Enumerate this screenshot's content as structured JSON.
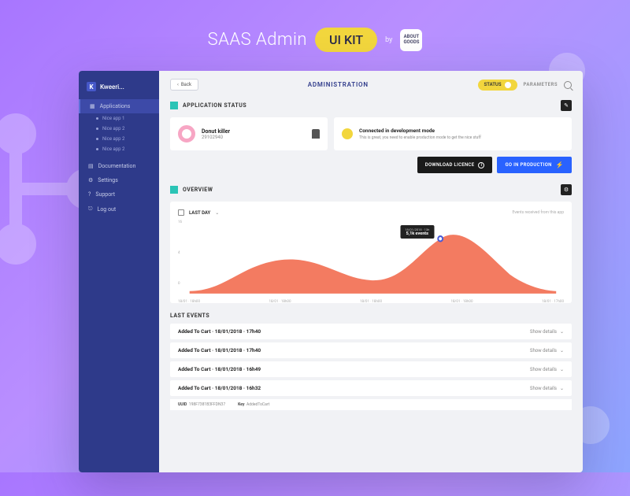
{
  "promo": {
    "title": "SAAS Admin",
    "badge": "UI KIT",
    "by": "by",
    "logo": "ABOUT GOODS"
  },
  "brand": {
    "letter": "K",
    "name": "Kweeri..."
  },
  "sidebar": {
    "applications": {
      "label": "Applications",
      "items": [
        "Nice app 1",
        "Nice app 2",
        "Nice app 2",
        "Nice app 2"
      ]
    },
    "documentation": "Documentation",
    "settings": "Settings",
    "support": "Support",
    "logout": "Log out"
  },
  "topbar": {
    "back": "Back",
    "title": "ADMINISTRATION",
    "status": "STATUS",
    "params": "PARAMETERS"
  },
  "status_section": {
    "title": "APPLICATION STATUS",
    "app": {
      "name": "Donut killer",
      "id": "29102940"
    },
    "conn": {
      "title": "Connected in development mode",
      "sub": "This is great, you need to enable production mode to get the nice stuff"
    },
    "btn_download": "DOWNLOAD LICENCE",
    "btn_prod": "GO IN PRODUCTION"
  },
  "overview": {
    "title": "OVERVIEW",
    "period": "LAST DAY",
    "note": "Events received from this app",
    "tooltip": {
      "date": "18/01/2018 · 13h",
      "value": "5,1k events"
    }
  },
  "chart_data": {
    "type": "area",
    "title": "Events received from this app",
    "xlabel": "",
    "ylabel": "",
    "ylim": [
      0,
      16
    ],
    "x_ticks": [
      "18/01 · 18h00",
      "18/01 · 18h00",
      "18/01 · 18h00",
      "18/01 · 18h00",
      "18/01 · 17h00"
    ],
    "y_ticks": [
      16,
      4,
      0
    ],
    "x": [
      0,
      1,
      2,
      3,
      4,
      5,
      6,
      7,
      8,
      9,
      10,
      11
    ],
    "values": [
      0,
      1,
      4,
      7,
      7,
      4,
      2,
      4,
      10,
      13,
      9,
      3
    ],
    "highlight": {
      "x": 9,
      "label": "18/01/2018 · 13h",
      "value_text": "5,1k events"
    }
  },
  "events": {
    "title": "LAST EVENTS",
    "show": "Show details",
    "rows": [
      {
        "name": "Added To Cart",
        "ts": "18/01/2018 · 17h40"
      },
      {
        "name": "Added To Cart",
        "ts": "18/01/2018 · 17h40"
      },
      {
        "name": "Added To Cart",
        "ts": "18/01/2018 · 16h49"
      },
      {
        "name": "Added To Cart",
        "ts": "18/01/2018 · 16h32"
      }
    ],
    "detail": {
      "uuid_k": "UUID",
      "uuid_v": "198F7381B3FFDN37",
      "key_k": "Key",
      "key_v": "AddedToCart"
    }
  }
}
